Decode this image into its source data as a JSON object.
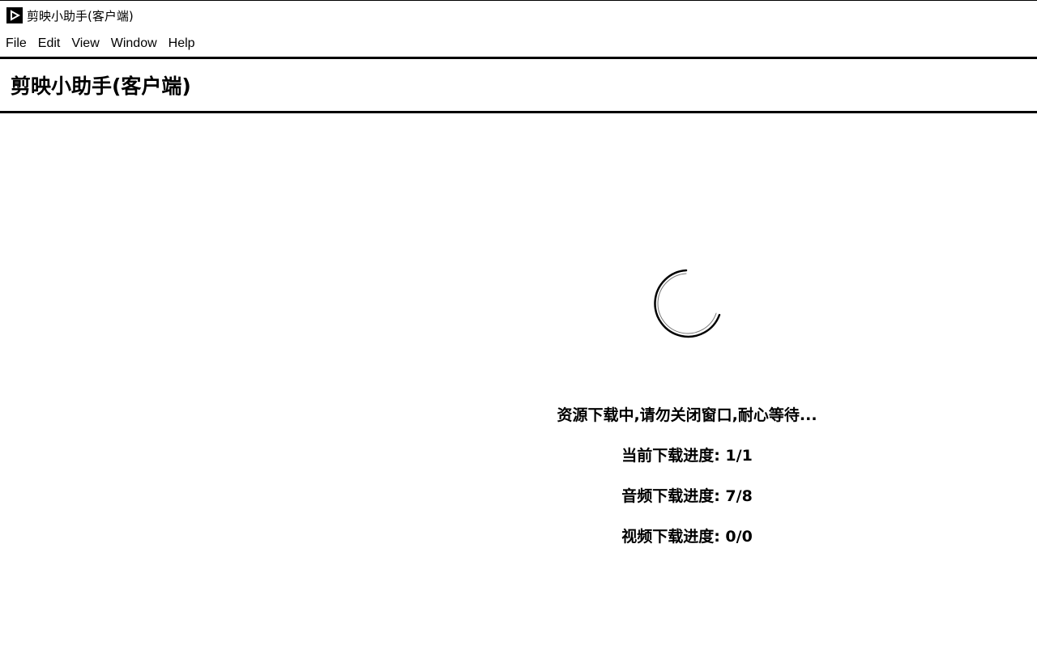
{
  "window": {
    "title": "剪映小助手(客户端)"
  },
  "menu": {
    "items": [
      "File",
      "Edit",
      "View",
      "Window",
      "Help"
    ]
  },
  "header": {
    "title": "剪映小助手(客户端)"
  },
  "status": {
    "message": "资源下载中,请勿关闭窗口,耐心等待...",
    "current_progress": "当前下载进度: 1/1",
    "audio_progress": "音频下载进度: 7/8",
    "video_progress": "视频下载进度: 0/0"
  },
  "icons": {
    "app": "play-icon",
    "loading": "loading-spinner-icon"
  }
}
